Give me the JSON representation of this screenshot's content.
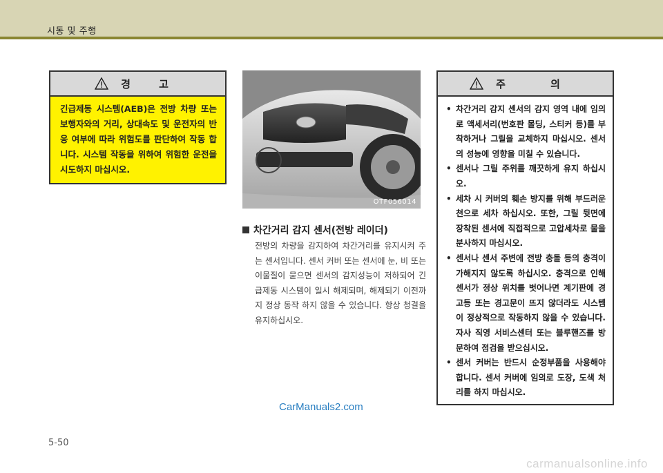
{
  "header": {
    "title": "시동 및 주행"
  },
  "warning": {
    "title": "경 고",
    "icon": "warning-triangle-icon",
    "text": "긴급제동 시스템(AEB)은 전방 차량 또는 보행자와의 거리, 상대속도 및 운전자의 반응 여부에 따라 위험도를 판단하여 작동 합니다. 시스템 작동을 위하여 위험한 운전을 시도하지 마십시오.",
    "background_color": "#fff200"
  },
  "photo": {
    "code": "OTF056014"
  },
  "section": {
    "heading": "차간거리 감지 센서(전방 레이더)",
    "body": "전방의 차량을 감지하여 차간거리를 유지시켜 주는 센서입니다. 센서 커버 또는 센서에 눈, 비 또는 이물질이 묻으면 센서의 감지성능이 저하되어 긴급제동 시스템이 일시 해제되며, 해제되기 이전까지 정상 동작 하지 않을 수 있습니다. 항상 청결을 유지하십시오."
  },
  "caution": {
    "title": "주 의",
    "icon": "warning-triangle-icon",
    "items": [
      "차간거리 감지 센서의 감지 영역 내에 임의로 액세서리(번호판 몰딩, 스티커 등)를 부착하거나 그릴을 교체하지 마십시오. 센서의 성능에 영향을 미칠 수 있습니다.",
      "센서나 그릴 주위를 깨끗하게 유지 하십시오.",
      "세차 시 커버의 훼손 방지를 위해 부드러운 천으로 세차 하십시오. 또한, 그릴 뒷면에 장착된 센서에 직접적으로 고압세차로 물을 분사하지 마십시오.",
      "센서나 센서 주변에 전방 충돌 등의 충격이 가해지지 않도록 하십시오. 충격으로 인해 센서가 정상 위치를 벗어나면 계기판에 경고등 또는 경고문이 뜨지 않더라도 시스템이 정상적으로 작동하지 않을 수 있습니다. 자사 직영 서비스센터 또는 블루핸즈를 방문하여 점검을 받으십시오.",
      "센서 커버는 반드시 순정부품을 사용해야 합니다. 센서 커버에 임의로 도장, 도색 처리를 하지 마십시오."
    ]
  },
  "page": {
    "number": "5-50"
  },
  "watermarks": {
    "center": "CarManuals2.com",
    "footer": "carmanualsonline.info"
  }
}
